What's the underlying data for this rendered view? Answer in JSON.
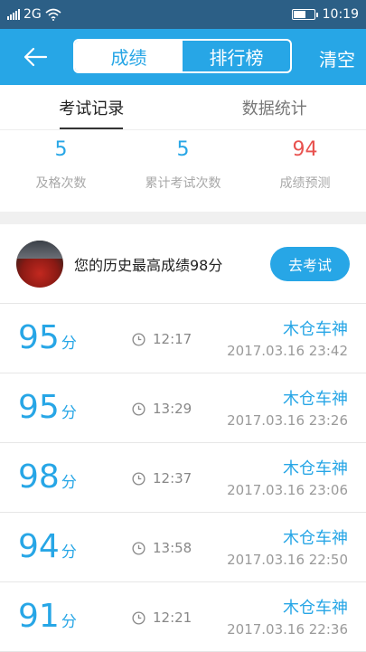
{
  "status_bar": {
    "network": "2G",
    "time": "10:19"
  },
  "nav": {
    "segments": [
      "成绩",
      "排行榜"
    ],
    "clear_label": "清空"
  },
  "tabs": [
    "考试记录",
    "数据统计"
  ],
  "stats": [
    {
      "value": "5",
      "label": "及格次数"
    },
    {
      "value": "5",
      "label": "累计考试次数"
    },
    {
      "value": "94",
      "label": "成绩预测"
    }
  ],
  "best": {
    "text": "您的历史最高成绩98分",
    "button_label": "去考试"
  },
  "records": [
    {
      "score": "95",
      "unit": "分",
      "duration": "12:17",
      "user": "木仓车神",
      "date": "2017.03.16 23:42"
    },
    {
      "score": "95",
      "unit": "分",
      "duration": "13:29",
      "user": "木仓车神",
      "date": "2017.03.16 23:26"
    },
    {
      "score": "98",
      "unit": "分",
      "duration": "12:37",
      "user": "木仓车神",
      "date": "2017.03.16 23:06"
    },
    {
      "score": "94",
      "unit": "分",
      "duration": "13:58",
      "user": "木仓车神",
      "date": "2017.03.16 22:50"
    },
    {
      "score": "91",
      "unit": "分",
      "duration": "12:21",
      "user": "木仓车神",
      "date": "2017.03.16 22:36"
    }
  ],
  "colors": {
    "accent": "#27a6e6",
    "prediction": "#e8524f",
    "status_bar": "#2c5f86"
  },
  "icons": {
    "back": "arrow-left-icon",
    "time": "clock-icon",
    "wifi": "wifi-icon",
    "battery": "battery-icon"
  }
}
